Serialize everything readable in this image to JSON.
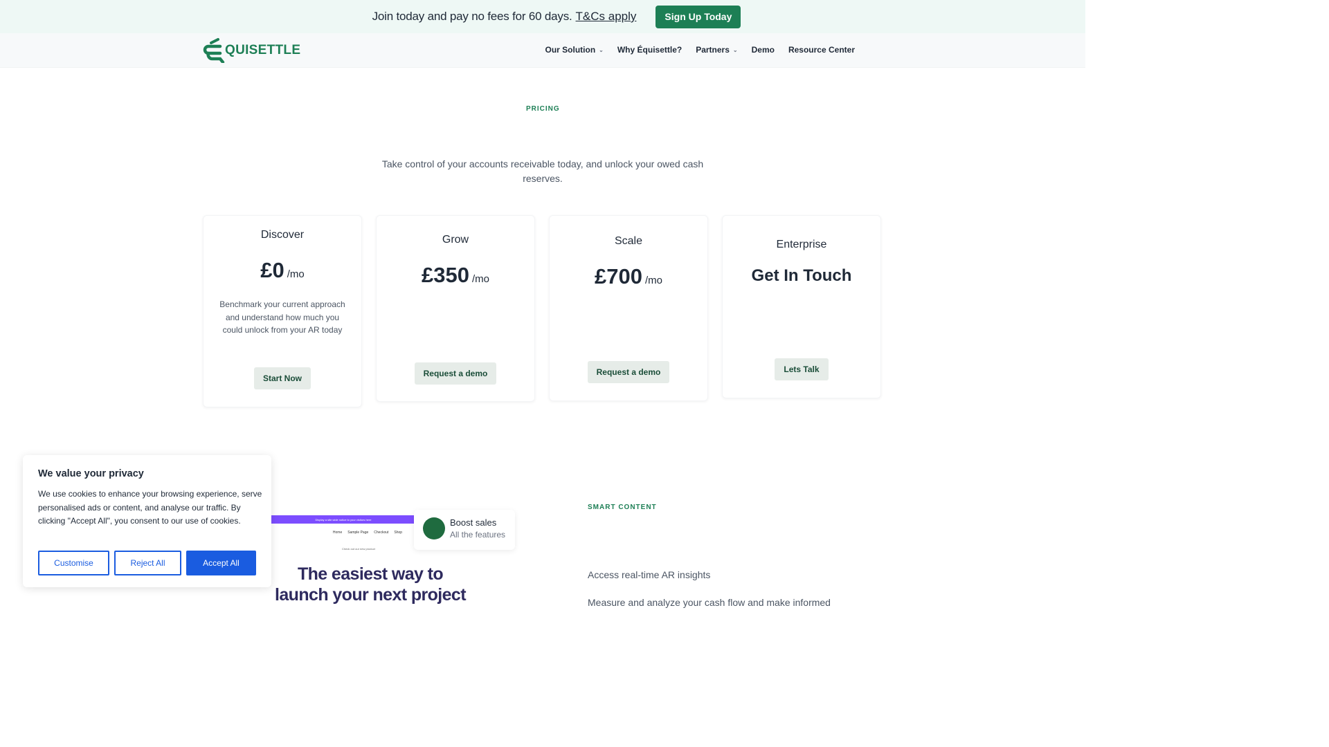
{
  "promo": {
    "text": "Join today and pay no fees for 60 days.",
    "link": "T&Cs apply",
    "button": "Sign Up Today"
  },
  "nav": {
    "logo_text": "QUISETTLE",
    "items": [
      {
        "label": "Our Solution",
        "has_dropdown": true
      },
      {
        "label": "Why Équisettle?",
        "has_dropdown": false
      },
      {
        "label": "Partners",
        "has_dropdown": true
      },
      {
        "label": "Demo",
        "has_dropdown": false
      },
      {
        "label": "Resource Center",
        "has_dropdown": false
      }
    ]
  },
  "pricing": {
    "label": "PRICING",
    "intro": "Take control of your accounts receivable today, and unlock your owed cash reserves.",
    "plans": [
      {
        "name": "Discover",
        "price": "£0",
        "per": "/mo",
        "description": "Benchmark your current approach and understand how much you could unlock from your AR today",
        "button": "Start Now"
      },
      {
        "name": "Grow",
        "price": "£350",
        "per": "/mo",
        "description": "",
        "button": "Request a demo"
      },
      {
        "name": "Scale",
        "price": "£700",
        "per": "/mo",
        "description": "",
        "button": "Request a demo"
      },
      {
        "name": "Enterprise",
        "price": "Get In Touch",
        "per": "",
        "description": "",
        "button": "Lets Talk"
      }
    ]
  },
  "smart": {
    "label": "SMART CONTENT",
    "heading": "Access real-time AR insights",
    "text": "Measure and analyze your cash flow and make informed"
  },
  "preview": {
    "topbar": "Display a site wide notice to your visitors here",
    "nav": [
      "Home",
      "Sample Page",
      "Checkout",
      "Shop"
    ],
    "badge": "Check out our new product",
    "heading": "The easiest way to launch your next project"
  },
  "boost": {
    "title": "Boost sales",
    "subtitle": "All the features"
  },
  "cookie": {
    "title": "We value your privacy",
    "text": "We use cookies to enhance your browsing experience, serve personalised ads or content, and analyse our traffic. By clicking \"Accept All\", you consent to our use of cookies.",
    "customise": "Customise",
    "reject": "Reject All",
    "accept": "Accept All"
  },
  "colors": {
    "brand_green": "#1d7f55",
    "accept_blue": "#1a5ce0",
    "promo_bg": "#eef8f5"
  }
}
